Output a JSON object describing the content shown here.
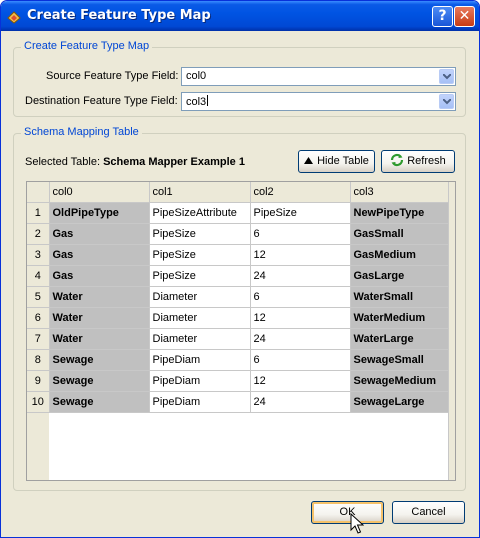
{
  "window": {
    "title": "Create Feature Type Map"
  },
  "feature_map": {
    "legend": "Create Feature Type Map",
    "source_label": "Source Feature Type Field:",
    "source_value": "col0",
    "dest_label": "Destination Feature Type Field:",
    "dest_value": "col3"
  },
  "schema": {
    "legend": "Schema Mapping Table",
    "selected_prefix": "Selected Table:",
    "selected_name": "Schema Mapper Example 1",
    "hide_label": "Hide Table",
    "refresh_label": "Refresh",
    "columns": [
      "col0",
      "col1",
      "col2",
      "col3"
    ],
    "rows": [
      [
        "1",
        "OldPipeType",
        "PipeSizeAttribute",
        "PipeSize",
        "NewPipeType"
      ],
      [
        "2",
        "Gas",
        "PipeSize",
        "6",
        "GasSmall"
      ],
      [
        "3",
        "Gas",
        "PipeSize",
        "12",
        "GasMedium"
      ],
      [
        "4",
        "Gas",
        "PipeSize",
        "24",
        "GasLarge"
      ],
      [
        "5",
        "Water",
        "Diameter",
        "6",
        "WaterSmall"
      ],
      [
        "6",
        "Water",
        "Diameter",
        "12",
        "WaterMedium"
      ],
      [
        "7",
        "Water",
        "Diameter",
        "24",
        "WaterLarge"
      ],
      [
        "8",
        "Sewage",
        "PipeDiam",
        "6",
        "SewageSmall"
      ],
      [
        "9",
        "Sewage",
        "PipeDiam",
        "12",
        "SewageMedium"
      ],
      [
        "10",
        "Sewage",
        "PipeDiam",
        "24",
        "SewageLarge"
      ]
    ]
  },
  "buttons": {
    "ok": "OK",
    "cancel": "Cancel"
  },
  "titlebar_buttons": {
    "help": "?",
    "close": "✕"
  },
  "colors": {
    "title_bar": "#0054E3",
    "dialog_bg": "#ECE9D8",
    "legend_text": "#0046D5",
    "grid_shaded": "#C0C0C0"
  }
}
